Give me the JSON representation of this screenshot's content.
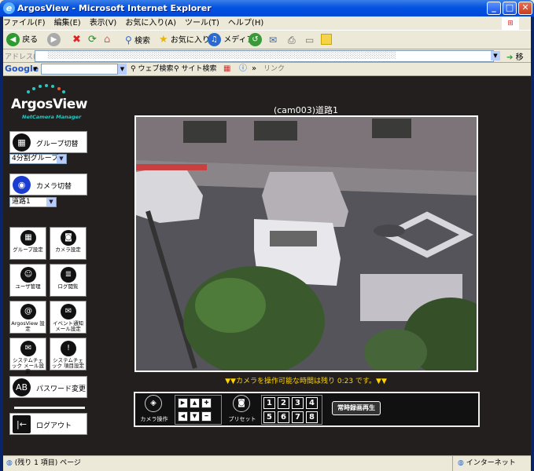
{
  "window": {
    "title": "ArgosView - Microsoft Internet Explorer"
  },
  "menu": {
    "items": [
      "ファイル(F)",
      "編集(E)",
      "表示(V)",
      "お気に入り(A)",
      "ツール(T)",
      "ヘルプ(H)"
    ]
  },
  "toolbar": {
    "back": "戻る",
    "search": "検索",
    "favorites": "お気に入り",
    "media": "メディア"
  },
  "address": {
    "label": "アドレス(D)",
    "go": "移動"
  },
  "google": {
    "logo": "Google",
    "web_search": "ウェブ検索",
    "site_search": "サイト検索",
    "link": "リンク"
  },
  "app": {
    "logo_name": "ArgosView",
    "logo_sub": "NetCamera Manager"
  },
  "sidebar": {
    "group_switch": "グループ切替",
    "group_select": "4分割グループ",
    "camera_switch": "カメラ切替",
    "camera_select": "道路1",
    "grid": [
      {
        "label": "グループ設定",
        "icon": "group-settings-icon"
      },
      {
        "label": "カメラ設定",
        "icon": "camera-settings-icon"
      },
      {
        "label": "ユーザ管理",
        "icon": "user-icon"
      },
      {
        "label": "ログ閲覧",
        "icon": "log-icon"
      },
      {
        "label": "ArgosView 設定",
        "icon": "at-icon"
      },
      {
        "label": "イベント通知 メール設定",
        "icon": "mail-icon"
      },
      {
        "label": "システムチェック メール設定",
        "icon": "mail-warning-icon"
      },
      {
        "label": "システムチェック 項目設定",
        "icon": "exclamation-icon"
      }
    ],
    "password_change": "パスワード変更",
    "logout": "ログアウト"
  },
  "camera": {
    "title": "(cam003)道路1",
    "notice": "▼▼カメラを操作可能な時間は残り 0:23 です。▼▼"
  },
  "controls": {
    "camera_op": "カメラ操作",
    "preset": "プリセット",
    "presets": [
      "1",
      "2",
      "3",
      "4",
      "5",
      "6",
      "7",
      "8"
    ],
    "recording_play": "常時録画再生"
  },
  "status": {
    "left": "(残り 1 項目) ページ",
    "zone": "インターネット"
  }
}
